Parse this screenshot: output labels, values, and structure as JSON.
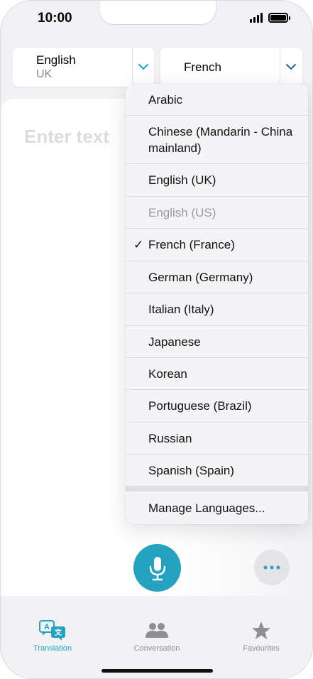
{
  "status_bar": {
    "time": "10:00"
  },
  "source_language": {
    "name": "English",
    "region": "UK"
  },
  "target_language": {
    "name": "French"
  },
  "input": {
    "placeholder": "Enter text"
  },
  "language_menu": {
    "items": [
      {
        "label": "Arabic",
        "selected": false,
        "disabled": false
      },
      {
        "label": "Chinese (Mandarin - China mainland)",
        "selected": false,
        "disabled": false
      },
      {
        "label": "English (UK)",
        "selected": false,
        "disabled": false
      },
      {
        "label": "English (US)",
        "selected": false,
        "disabled": true
      },
      {
        "label": "French (France)",
        "selected": true,
        "disabled": false
      },
      {
        "label": "German (Germany)",
        "selected": false,
        "disabled": false
      },
      {
        "label": "Italian (Italy)",
        "selected": false,
        "disabled": false
      },
      {
        "label": "Japanese",
        "selected": false,
        "disabled": false
      },
      {
        "label": "Korean",
        "selected": false,
        "disabled": false
      },
      {
        "label": "Portuguese (Brazil)",
        "selected": false,
        "disabled": false
      },
      {
        "label": "Russian",
        "selected": false,
        "disabled": false
      },
      {
        "label": "Spanish (Spain)",
        "selected": false,
        "disabled": false
      }
    ],
    "checkmark": "✓",
    "manage_label": "Manage Languages..."
  },
  "tabs": {
    "translation": "Translation",
    "conversation": "Conversation",
    "favourites": "Favourites"
  },
  "colors": {
    "accent": "#23a3c1",
    "inactive": "#8e8e93"
  },
  "icons": {
    "microphone": "microphone-icon",
    "more": "ellipsis-icon",
    "translation": "translate-icon",
    "conversation": "people-icon",
    "favourites": "star-icon"
  }
}
